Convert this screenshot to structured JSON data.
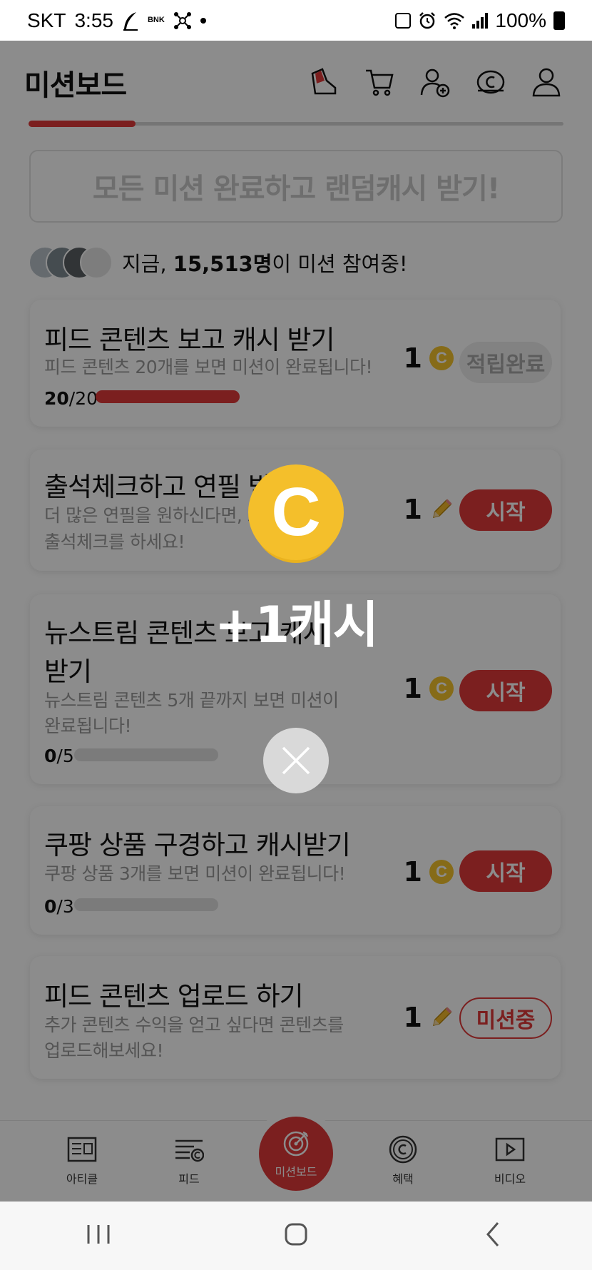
{
  "status_bar": {
    "carrier": "SKT",
    "time": "3:55",
    "bank_label": "BNK",
    "battery": "100%"
  },
  "header": {
    "title": "미션보드"
  },
  "banner": {
    "text": "모든 미션 완료하고 랜덤캐시 받기!"
  },
  "participants": {
    "prefix": "지금, ",
    "count": "15,513명",
    "suffix": "이 미션 참여중!"
  },
  "missions": [
    {
      "title": "피드 콘텐츠 보고 캐시 받기",
      "desc_lines": [
        "피드 콘텐츠 20개를 보면 미션이 완료됩니다!"
      ],
      "progress_current": "20",
      "progress_total": "/20",
      "progress_fraction": 1.0,
      "reward": "1",
      "reward_icon": "coin-icon",
      "button": "적립완료"
    },
    {
      "title": "출석체크하고 연필 받기",
      "desc_lines": [
        "더 많은 연필을 원하신다면, 오늘도",
        "출석체크를 하세요!"
      ],
      "reward": "1",
      "reward_icon": "pencil-icon",
      "button": "시작"
    },
    {
      "title_lines": [
        "뉴스트림 콘텐츠 보고 캐시",
        "받기"
      ],
      "desc_lines": [
        "뉴스트림 콘텐츠 5개 끝까지 보면 미션이",
        "완료됩니다!"
      ],
      "progress_current": "0",
      "progress_total": "/5",
      "progress_fraction": 0,
      "reward": "1",
      "reward_icon": "coin-icon",
      "button": "시작"
    },
    {
      "title": "쿠팡 상품 구경하고 캐시받기",
      "desc_lines": [
        "쿠팡 상품 3개를 보면 미션이 완료됩니다!"
      ],
      "progress_current": "0",
      "progress_total": "/3",
      "progress_fraction": 0,
      "reward": "1",
      "reward_icon": "coin-icon",
      "button": "시작"
    },
    {
      "title": "피드 콘텐츠 업로드 하기",
      "desc_lines": [
        "추가 콘텐츠 수익을 얻고 싶다면 콘텐츠를",
        "업로드해보세요!"
      ],
      "reward": "1",
      "reward_icon": "pencil-icon",
      "button": "미션중"
    }
  ],
  "bottom_nav": {
    "items": [
      "아티클",
      "피드",
      "미션보드",
      "혜택",
      "비디오"
    ],
    "active": "미션보드"
  },
  "popup": {
    "coin_letter": "C",
    "reward_text": "+1캐시"
  },
  "colors": {
    "accent": "#e03a3a",
    "coin": "#f4bf2b"
  }
}
